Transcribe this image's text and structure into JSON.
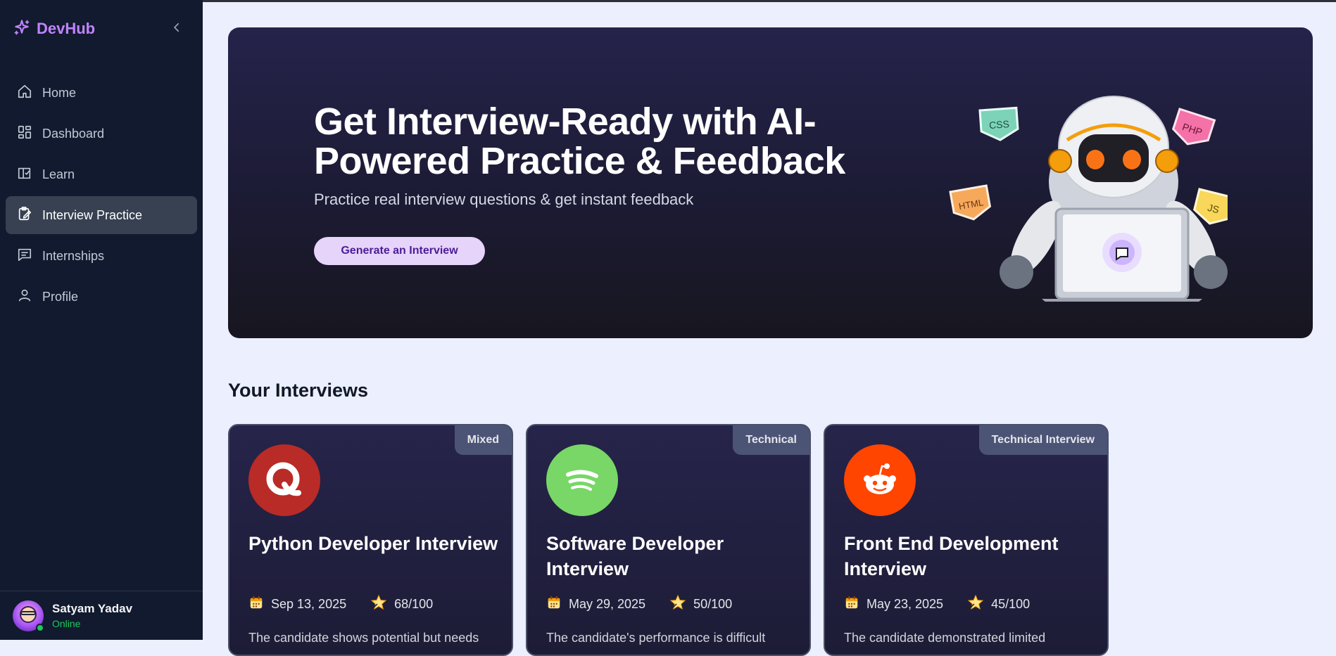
{
  "brand": {
    "name": "DevHub",
    "accent": "#c084fc"
  },
  "sidebar": {
    "items": [
      {
        "label": "Home",
        "icon": "home-icon"
      },
      {
        "label": "Dashboard",
        "icon": "dashboard-icon"
      },
      {
        "label": "Learn",
        "icon": "book-icon"
      },
      {
        "label": "Interview Practice",
        "icon": "clipboard-edit-icon",
        "active": true
      },
      {
        "label": "Internships",
        "icon": "message-lines-icon"
      },
      {
        "label": "Profile",
        "icon": "user-icon"
      }
    ]
  },
  "user": {
    "name": "Satyam Yadav",
    "status": "Online"
  },
  "hero": {
    "title": "Get Interview-Ready with AI-Powered Practice & Feedback",
    "subtitle": "Practice real interview questions & get instant feedback",
    "button_label": "Generate an Interview",
    "stickers": [
      "CSS",
      "PHP",
      "HTML",
      "JS"
    ]
  },
  "interviews": {
    "section_title": "Your Interviews",
    "cards": [
      {
        "badge": "Mixed",
        "logo": "quora-logo",
        "logo_color": "#b92b27",
        "title": "Python Developer Interview",
        "date": "Sep 13, 2025",
        "score": "68/100",
        "description": "The candidate shows potential but needs"
      },
      {
        "badge": "Technical",
        "logo": "spotify-logo",
        "logo_color": "#78d766",
        "title": "Software Developer Interview",
        "date": "May 29, 2025",
        "score": "50/100",
        "description": "The candidate's performance is difficult"
      },
      {
        "badge": "Technical Interview",
        "logo": "reddit-logo",
        "logo_color": "#ff4500",
        "title": "Front End Development Interview",
        "date": "May 23, 2025",
        "score": "45/100",
        "description": "The candidate demonstrated limited"
      }
    ]
  }
}
